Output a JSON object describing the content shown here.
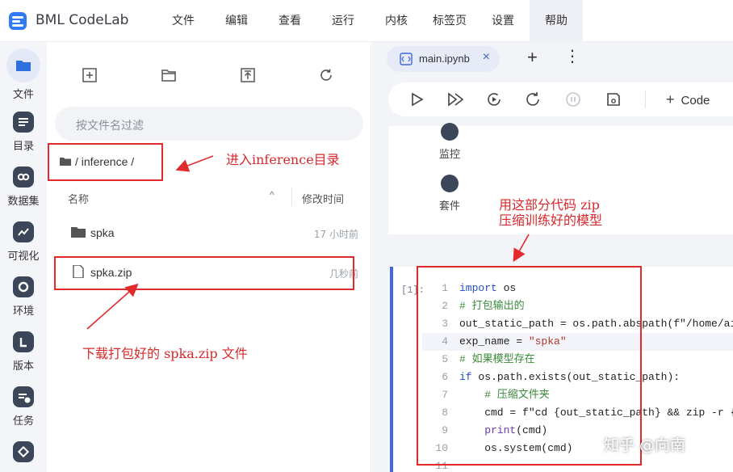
{
  "app": {
    "title": "BML CodeLab"
  },
  "menu": [
    "文件",
    "编辑",
    "查看",
    "运行",
    "内核",
    "标签页",
    "设置",
    "帮助"
  ],
  "rail": [
    "文件",
    "目录",
    "数据集",
    "可视化",
    "环境",
    "版本",
    "任务"
  ],
  "file_panel": {
    "filter_placeholder": "按文件名过滤",
    "breadcrumb": "/ inference /",
    "col_name": "名称",
    "col_modified": "修改时间",
    "sort_indicator": "^",
    "files": [
      {
        "name": "spka",
        "time": "17 小时前",
        "type": "folder"
      },
      {
        "name": "spka.zip",
        "time": "几秒前",
        "type": "file"
      }
    ]
  },
  "editor": {
    "tab_label": "main.ipynb",
    "tab_close": "×",
    "add_tab": "+",
    "more": "⋮",
    "code_button": "Code",
    "panel_items": [
      "监控",
      "套件"
    ],
    "cell_prompt": "[1]:",
    "code_lines": [
      {
        "n": "1",
        "cls": "kw",
        "text": "import",
        "rest": " os"
      },
      {
        "n": "2",
        "cls": "cm",
        "text": "# 打包输出的",
        "rest": ""
      },
      {
        "n": "3",
        "cls": "pl",
        "text": "out_static_path = os.path.abspath(f\"/home/aistudio",
        "rest": ""
      },
      {
        "n": "4",
        "cls": "pl",
        "text": "exp_name = ",
        "rest": "\"spka\""
      },
      {
        "n": "5",
        "cls": "cm",
        "text": "# 如果模型存在",
        "rest": ""
      },
      {
        "n": "6",
        "cls": "kw",
        "text": "if",
        "rest": " os.path.exists(out_static_path):"
      },
      {
        "n": "7",
        "cls": "cm",
        "text": "    # 压缩文件夹",
        "rest": ""
      },
      {
        "n": "8",
        "cls": "pl",
        "text": "    cmd = f\"cd {out_static_path} && zip -r {exp_name}",
        "rest": ""
      },
      {
        "n": "9",
        "cls": "bi",
        "text": "    print",
        "rest": "(cmd)"
      },
      {
        "n": "10",
        "cls": "pl",
        "text": "    os.system(cmd)",
        "rest": ""
      },
      {
        "n": "11",
        "cls": "pl",
        "text": "",
        "rest": ""
      }
    ]
  },
  "annotations": {
    "enter_dir": "进入inference目录",
    "zip_code": "用这部分代码 zip\n压缩训练好的模型",
    "download": "下载打包好的 spka.zip 文件"
  },
  "watermark": "知乎 @向南",
  "colors": {
    "accent": "#3e6ae1",
    "annotation": "#e3292c",
    "rail_bg": "#f4f5f8"
  }
}
